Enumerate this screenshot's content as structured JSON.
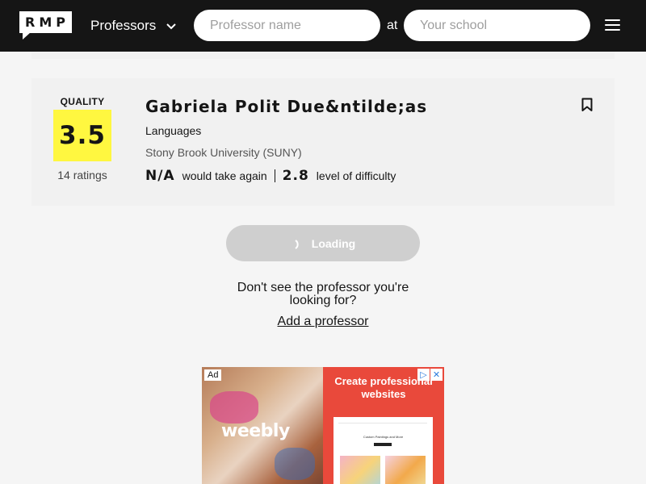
{
  "header": {
    "logo_text": "RMP",
    "search_type": "Professors",
    "name_placeholder": "Professor name",
    "at_text": "at",
    "school_placeholder": "Your school"
  },
  "professor_card": {
    "quality_label": "QUALITY",
    "rating": "3.5",
    "num_ratings": "14 ratings",
    "name": "Gabriela Polit Due&ntilde;as",
    "department": "Languages",
    "school": "Stony Brook University (SUNY)",
    "would_take_again_value": "N/A",
    "would_take_again_label": "would take again",
    "difficulty_value": "2.8",
    "difficulty_label": "level of difficulty"
  },
  "loading": {
    "button_label": "Loading"
  },
  "footer": {
    "dont_see": "Don't see the professor you're looking for?",
    "add_professor": "Add a professor"
  },
  "ad": {
    "badge": "Ad",
    "brand": "weebly",
    "headline": "Create professional websites",
    "screen_title": "Custom Paintings and More"
  },
  "colors": {
    "header_bg": "#151515",
    "rating_box": "#fff740",
    "card_bg": "#f1f1f1",
    "page_bg": "#f5f5f5",
    "ad_accent": "#e9493b"
  }
}
